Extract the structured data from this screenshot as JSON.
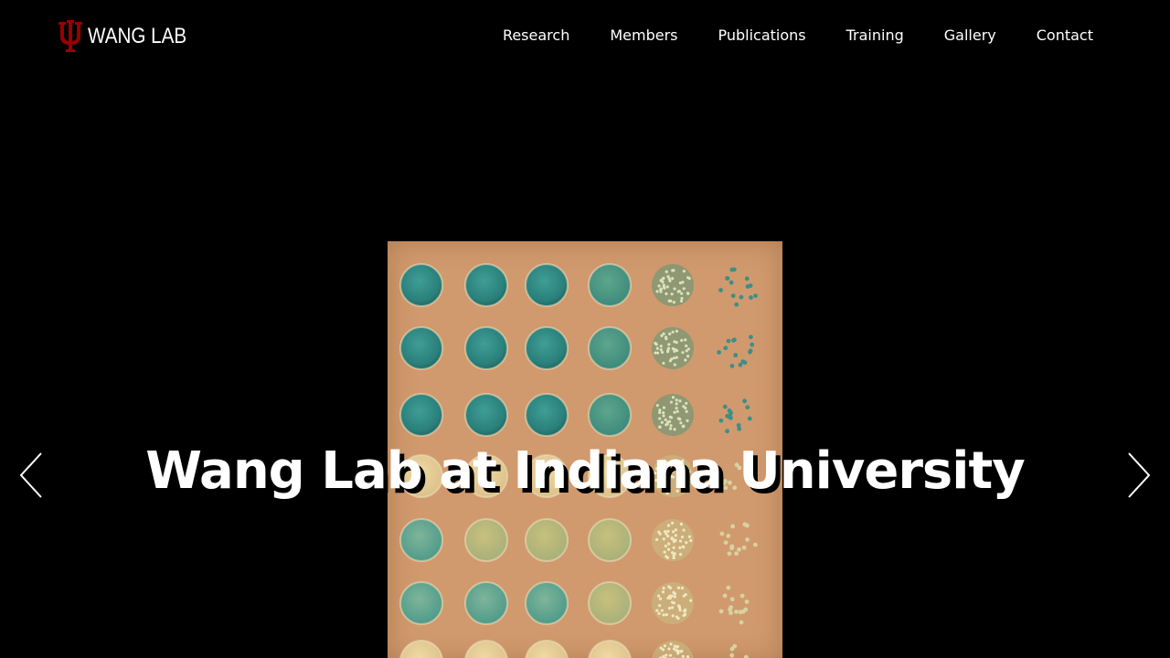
{
  "site": {
    "logo_text": "WANG LAB",
    "logo_icon": "iu-trident-icon",
    "brand_color": "#990000"
  },
  "nav": {
    "items": [
      {
        "label": "Research"
      },
      {
        "label": "Members"
      },
      {
        "label": "Publications"
      },
      {
        "label": "Training"
      },
      {
        "label": "Gallery"
      },
      {
        "label": "Contact"
      }
    ]
  },
  "hero": {
    "title": "Wang Lab at Indiana University",
    "image": "yeast-spot-assay-plate",
    "prev_icon": "chevron-left-icon",
    "next_icon": "chevron-right-icon"
  },
  "colors": {
    "background": "#000000",
    "text": "#ffffff",
    "plate": "#d09a6e",
    "colony_blue": "#2f8a85",
    "colony_pale": "#c9bf7a"
  }
}
